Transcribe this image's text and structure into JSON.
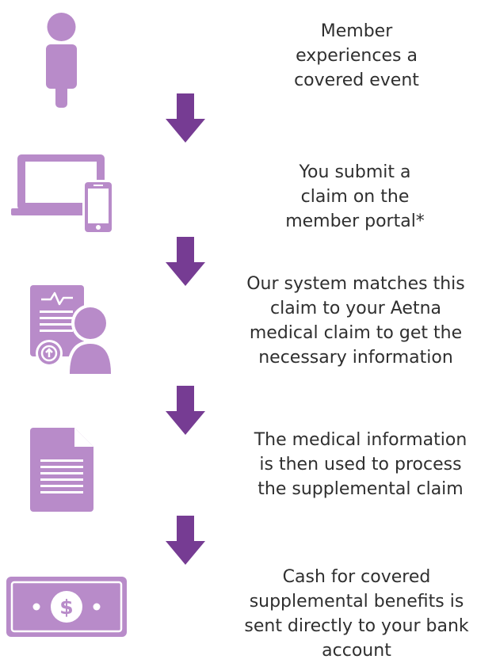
{
  "colors": {
    "icon": "#b88bc9",
    "arrow": "#763c93",
    "text": "#2f2f2f"
  },
  "steps": [
    {
      "icon": "person-icon",
      "text": "Member\nexperiences a\ncovered event"
    },
    {
      "icon": "laptop-phone-icon",
      "text": "You submit a\nclaim on the\nmember portal*"
    },
    {
      "icon": "claim-document-person-icon",
      "text": "Our system matches this\nclaim to your Aetna\nmedical claim to get the\nnecessary information"
    },
    {
      "icon": "document-icon",
      "text": "The medical information\nis then used to process\nthe supplemental claim"
    },
    {
      "icon": "cash-bill-icon",
      "text": "Cash for covered\nsupplemental benefits is\nsent directly to your bank\naccount"
    }
  ],
  "cash_symbol": "$"
}
